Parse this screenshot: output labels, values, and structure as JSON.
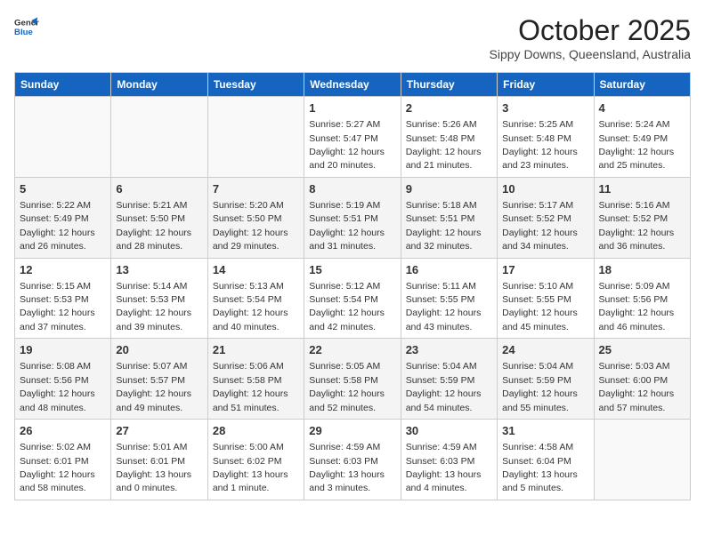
{
  "header": {
    "logo_line1": "General",
    "logo_line2": "Blue",
    "month": "October 2025",
    "location": "Sippy Downs, Queensland, Australia"
  },
  "days_of_week": [
    "Sunday",
    "Monday",
    "Tuesday",
    "Wednesday",
    "Thursday",
    "Friday",
    "Saturday"
  ],
  "weeks": [
    [
      {
        "day": "",
        "info": ""
      },
      {
        "day": "",
        "info": ""
      },
      {
        "day": "",
        "info": ""
      },
      {
        "day": "1",
        "info": "Sunrise: 5:27 AM\nSunset: 5:47 PM\nDaylight: 12 hours and 20 minutes."
      },
      {
        "day": "2",
        "info": "Sunrise: 5:26 AM\nSunset: 5:48 PM\nDaylight: 12 hours and 21 minutes."
      },
      {
        "day": "3",
        "info": "Sunrise: 5:25 AM\nSunset: 5:48 PM\nDaylight: 12 hours and 23 minutes."
      },
      {
        "day": "4",
        "info": "Sunrise: 5:24 AM\nSunset: 5:49 PM\nDaylight: 12 hours and 25 minutes."
      }
    ],
    [
      {
        "day": "5",
        "info": "Sunrise: 5:22 AM\nSunset: 5:49 PM\nDaylight: 12 hours and 26 minutes."
      },
      {
        "day": "6",
        "info": "Sunrise: 5:21 AM\nSunset: 5:50 PM\nDaylight: 12 hours and 28 minutes."
      },
      {
        "day": "7",
        "info": "Sunrise: 5:20 AM\nSunset: 5:50 PM\nDaylight: 12 hours and 29 minutes."
      },
      {
        "day": "8",
        "info": "Sunrise: 5:19 AM\nSunset: 5:51 PM\nDaylight: 12 hours and 31 minutes."
      },
      {
        "day": "9",
        "info": "Sunrise: 5:18 AM\nSunset: 5:51 PM\nDaylight: 12 hours and 32 minutes."
      },
      {
        "day": "10",
        "info": "Sunrise: 5:17 AM\nSunset: 5:52 PM\nDaylight: 12 hours and 34 minutes."
      },
      {
        "day": "11",
        "info": "Sunrise: 5:16 AM\nSunset: 5:52 PM\nDaylight: 12 hours and 36 minutes."
      }
    ],
    [
      {
        "day": "12",
        "info": "Sunrise: 5:15 AM\nSunset: 5:53 PM\nDaylight: 12 hours and 37 minutes."
      },
      {
        "day": "13",
        "info": "Sunrise: 5:14 AM\nSunset: 5:53 PM\nDaylight: 12 hours and 39 minutes."
      },
      {
        "day": "14",
        "info": "Sunrise: 5:13 AM\nSunset: 5:54 PM\nDaylight: 12 hours and 40 minutes."
      },
      {
        "day": "15",
        "info": "Sunrise: 5:12 AM\nSunset: 5:54 PM\nDaylight: 12 hours and 42 minutes."
      },
      {
        "day": "16",
        "info": "Sunrise: 5:11 AM\nSunset: 5:55 PM\nDaylight: 12 hours and 43 minutes."
      },
      {
        "day": "17",
        "info": "Sunrise: 5:10 AM\nSunset: 5:55 PM\nDaylight: 12 hours and 45 minutes."
      },
      {
        "day": "18",
        "info": "Sunrise: 5:09 AM\nSunset: 5:56 PM\nDaylight: 12 hours and 46 minutes."
      }
    ],
    [
      {
        "day": "19",
        "info": "Sunrise: 5:08 AM\nSunset: 5:56 PM\nDaylight: 12 hours and 48 minutes."
      },
      {
        "day": "20",
        "info": "Sunrise: 5:07 AM\nSunset: 5:57 PM\nDaylight: 12 hours and 49 minutes."
      },
      {
        "day": "21",
        "info": "Sunrise: 5:06 AM\nSunset: 5:58 PM\nDaylight: 12 hours and 51 minutes."
      },
      {
        "day": "22",
        "info": "Sunrise: 5:05 AM\nSunset: 5:58 PM\nDaylight: 12 hours and 52 minutes."
      },
      {
        "day": "23",
        "info": "Sunrise: 5:04 AM\nSunset: 5:59 PM\nDaylight: 12 hours and 54 minutes."
      },
      {
        "day": "24",
        "info": "Sunrise: 5:04 AM\nSunset: 5:59 PM\nDaylight: 12 hours and 55 minutes."
      },
      {
        "day": "25",
        "info": "Sunrise: 5:03 AM\nSunset: 6:00 PM\nDaylight: 12 hours and 57 minutes."
      }
    ],
    [
      {
        "day": "26",
        "info": "Sunrise: 5:02 AM\nSunset: 6:01 PM\nDaylight: 12 hours and 58 minutes."
      },
      {
        "day": "27",
        "info": "Sunrise: 5:01 AM\nSunset: 6:01 PM\nDaylight: 13 hours and 0 minutes."
      },
      {
        "day": "28",
        "info": "Sunrise: 5:00 AM\nSunset: 6:02 PM\nDaylight: 13 hours and 1 minute."
      },
      {
        "day": "29",
        "info": "Sunrise: 4:59 AM\nSunset: 6:03 PM\nDaylight: 13 hours and 3 minutes."
      },
      {
        "day": "30",
        "info": "Sunrise: 4:59 AM\nSunset: 6:03 PM\nDaylight: 13 hours and 4 minutes."
      },
      {
        "day": "31",
        "info": "Sunrise: 4:58 AM\nSunset: 6:04 PM\nDaylight: 13 hours and 5 minutes."
      },
      {
        "day": "",
        "info": ""
      }
    ]
  ]
}
